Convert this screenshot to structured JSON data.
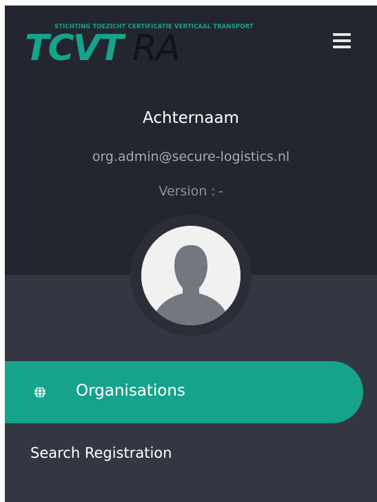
{
  "logo": {
    "tagline": "STICHTING TOEZICHT CERTIFICATIE VERTICAAL TRANSPORT",
    "main": "TCVT",
    "sub": "RA"
  },
  "user": {
    "name": "Achternaam",
    "email": "org.admin@secure-logistics.nl"
  },
  "version": {
    "label": "Version",
    "separator": ":",
    "value": "-"
  },
  "nav": {
    "items": [
      {
        "label": "Organisations",
        "icon": "globe-icon",
        "active": true
      },
      {
        "label": "Search Registration",
        "icon": "",
        "active": false
      }
    ]
  },
  "colors": {
    "accent": "#16a38c",
    "header_bg": "#23262f",
    "sidebar_bg": "#343742"
  }
}
